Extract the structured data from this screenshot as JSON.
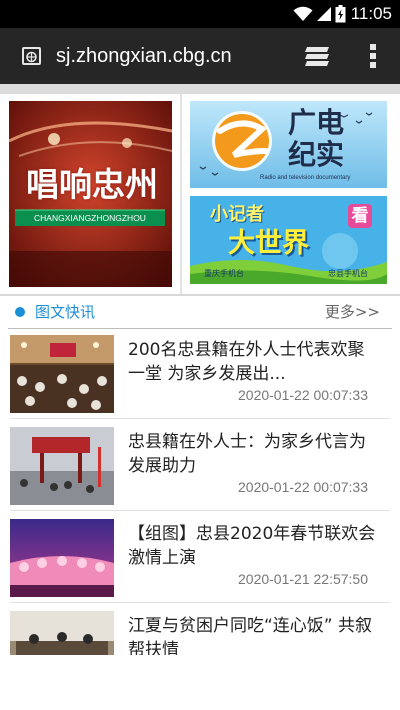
{
  "status_bar": {
    "time": "11:05"
  },
  "browser": {
    "url": "sj.zhongxian.cbg.cn"
  },
  "banners": {
    "left": {
      "title": "唱响忠州",
      "subtitle": "CHANGXIANGZHONGZHOU"
    },
    "right_top": {
      "title_line1": "广电",
      "title_line2": "纪实",
      "subtitle": "Radio and television documentary"
    },
    "right_bottom": {
      "title_line1": "小记者",
      "badge": "看",
      "title_line2": "大世界",
      "logo_left": "重庆手机台",
      "logo_right": "忠县手机台"
    }
  },
  "section": {
    "title": "图文快讯",
    "more_label": "更多>>"
  },
  "news": [
    {
      "headline": "200名忠县籍在外人士代表欢聚一堂 为家乡发展出...",
      "time": "2020-01-22 00:07:33"
    },
    {
      "headline": "忠县籍在外人士：为家乡代言为发展助力",
      "time": "2020-01-22 00:07:33"
    },
    {
      "headline": "【组图】忠县2020年春节联欢会激情上演",
      "time": "2020-01-21 22:57:50"
    },
    {
      "headline": "江夏与贫困户同吃“连心饭” 共叙帮扶情"
    }
  ]
}
